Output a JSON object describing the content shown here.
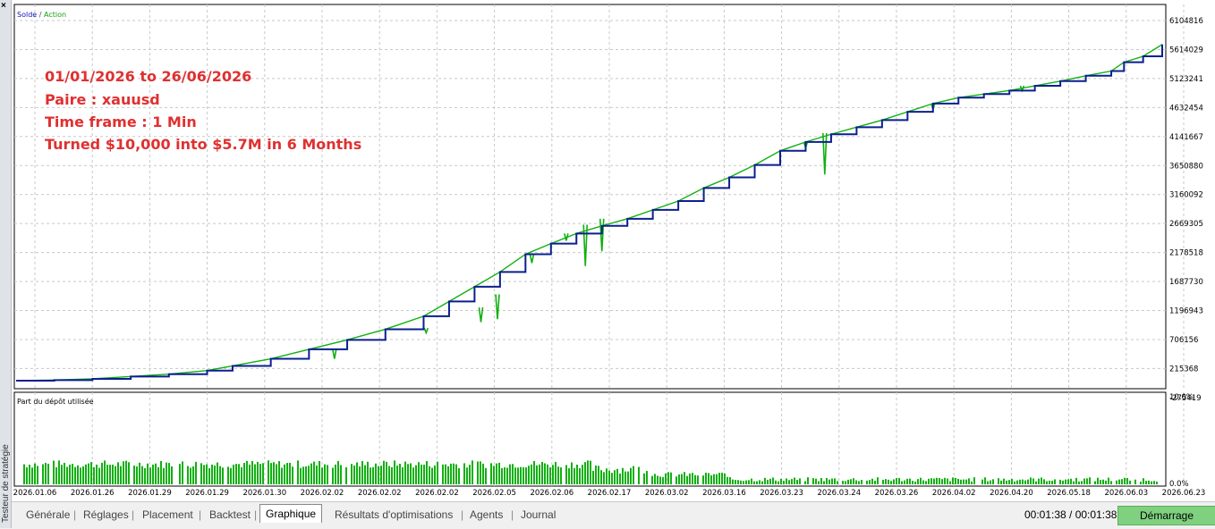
{
  "sidebar": {
    "vertical_label": "Testeur de stratégie",
    "close_glyph": "×"
  },
  "chart": {
    "legend_solde": "Solde",
    "legend_sep": " / ",
    "legend_action": "Action",
    "annotation": [
      "01/01/2026  to 26/06/2026",
      "Paire : xauusd",
      "Time frame : 1 Min",
      "Turned $10,000 into $5.7M in 6 Months"
    ],
    "subpanel_label": "Part du dépôt utilisée",
    "colors": {
      "balance": "#0b1f8f",
      "equity": "#10b010",
      "annotation": "#e03030",
      "grid": "#c8c8c8",
      "bars": "#10b010"
    }
  },
  "chart_data": {
    "type": "line",
    "series": [
      {
        "name": "Solde"
      },
      {
        "name": "Action"
      }
    ],
    "y_ticks": [
      "6104816",
      "5614029",
      "5123241",
      "4632454",
      "4141667",
      "3650880",
      "3160092",
      "2669305",
      "2178518",
      "1687730",
      "1196943",
      "706156",
      "215368",
      "-275419"
    ],
    "sub_y_ticks": [
      "10.0%",
      "0.0%"
    ],
    "x_ticks": [
      "2026.01.06",
      "2026.01.26",
      "2026.01.29",
      "2026.01.29",
      "2026.01.30",
      "2026.02.02",
      "2026.02.02",
      "2026.02.02",
      "2026.02.05",
      "2026.02.06",
      "2026.02.17",
      "2026.03.02",
      "2026.03.16",
      "2026.03.23",
      "2026.03.24",
      "2026.03.26",
      "2026.04.02",
      "2026.04.20",
      "2026.05.18",
      "2026.06.03",
      "2026.06.23"
    ],
    "balance_points": [
      [
        0,
        10000
      ],
      [
        30,
        20000
      ],
      [
        60,
        40000
      ],
      [
        90,
        80000
      ],
      [
        120,
        120000
      ],
      [
        150,
        180000
      ],
      [
        170,
        260000
      ],
      [
        200,
        380000
      ],
      [
        230,
        540000
      ],
      [
        260,
        700000
      ],
      [
        290,
        880000
      ],
      [
        320,
        1100000
      ],
      [
        340,
        1350000
      ],
      [
        360,
        1600000
      ],
      [
        380,
        1850000
      ],
      [
        400,
        2150000
      ],
      [
        420,
        2330000
      ],
      [
        440,
        2500000
      ],
      [
        460,
        2630000
      ],
      [
        480,
        2750000
      ],
      [
        500,
        2900000
      ],
      [
        520,
        3050000
      ],
      [
        540,
        3270000
      ],
      [
        560,
        3450000
      ],
      [
        580,
        3660000
      ],
      [
        600,
        3900000
      ],
      [
        620,
        4050000
      ],
      [
        640,
        4180000
      ],
      [
        660,
        4300000
      ],
      [
        680,
        4420000
      ],
      [
        700,
        4560000
      ],
      [
        720,
        4700000
      ],
      [
        740,
        4800000
      ],
      [
        760,
        4860000
      ],
      [
        780,
        4920000
      ],
      [
        800,
        5000000
      ],
      [
        820,
        5080000
      ],
      [
        840,
        5170000
      ],
      [
        860,
        5250000
      ],
      [
        870,
        5400000
      ],
      [
        885,
        5500000
      ],
      [
        900,
        5700000
      ]
    ],
    "equity_dips": [
      [
        250,
        540000,
        380000
      ],
      [
        322,
        900000,
        820000
      ],
      [
        365,
        1250000,
        1000000
      ],
      [
        378,
        1470000,
        1050000
      ],
      [
        405,
        2150000,
        2000000
      ],
      [
        432,
        2500000,
        2380000
      ],
      [
        447,
        2650000,
        1950000
      ],
      [
        460,
        2750000,
        2200000
      ],
      [
        620,
        4050000,
        3950000
      ],
      [
        635,
        4200000,
        3500000
      ],
      [
        720,
        4700000,
        4600000
      ],
      [
        790,
        5000000,
        4920000
      ]
    ],
    "ylim": [
      -275419,
      6300000
    ],
    "sub_ylim": [
      0,
      10
    ]
  },
  "tabs": [
    {
      "label": "Générale",
      "active": false
    },
    {
      "label": "Réglages",
      "active": false
    },
    {
      "label": "Placement",
      "active": false
    },
    {
      "label": "Backtest",
      "active": false
    },
    {
      "label": "Graphique",
      "active": true
    },
    {
      "label": "Résultats d'optimisations",
      "active": false
    },
    {
      "label": "Agents",
      "active": false
    },
    {
      "label": "Journal",
      "active": false
    }
  ],
  "status": {
    "timer": "00:01:38 / 00:01:38",
    "start_button": "Démarrage"
  }
}
